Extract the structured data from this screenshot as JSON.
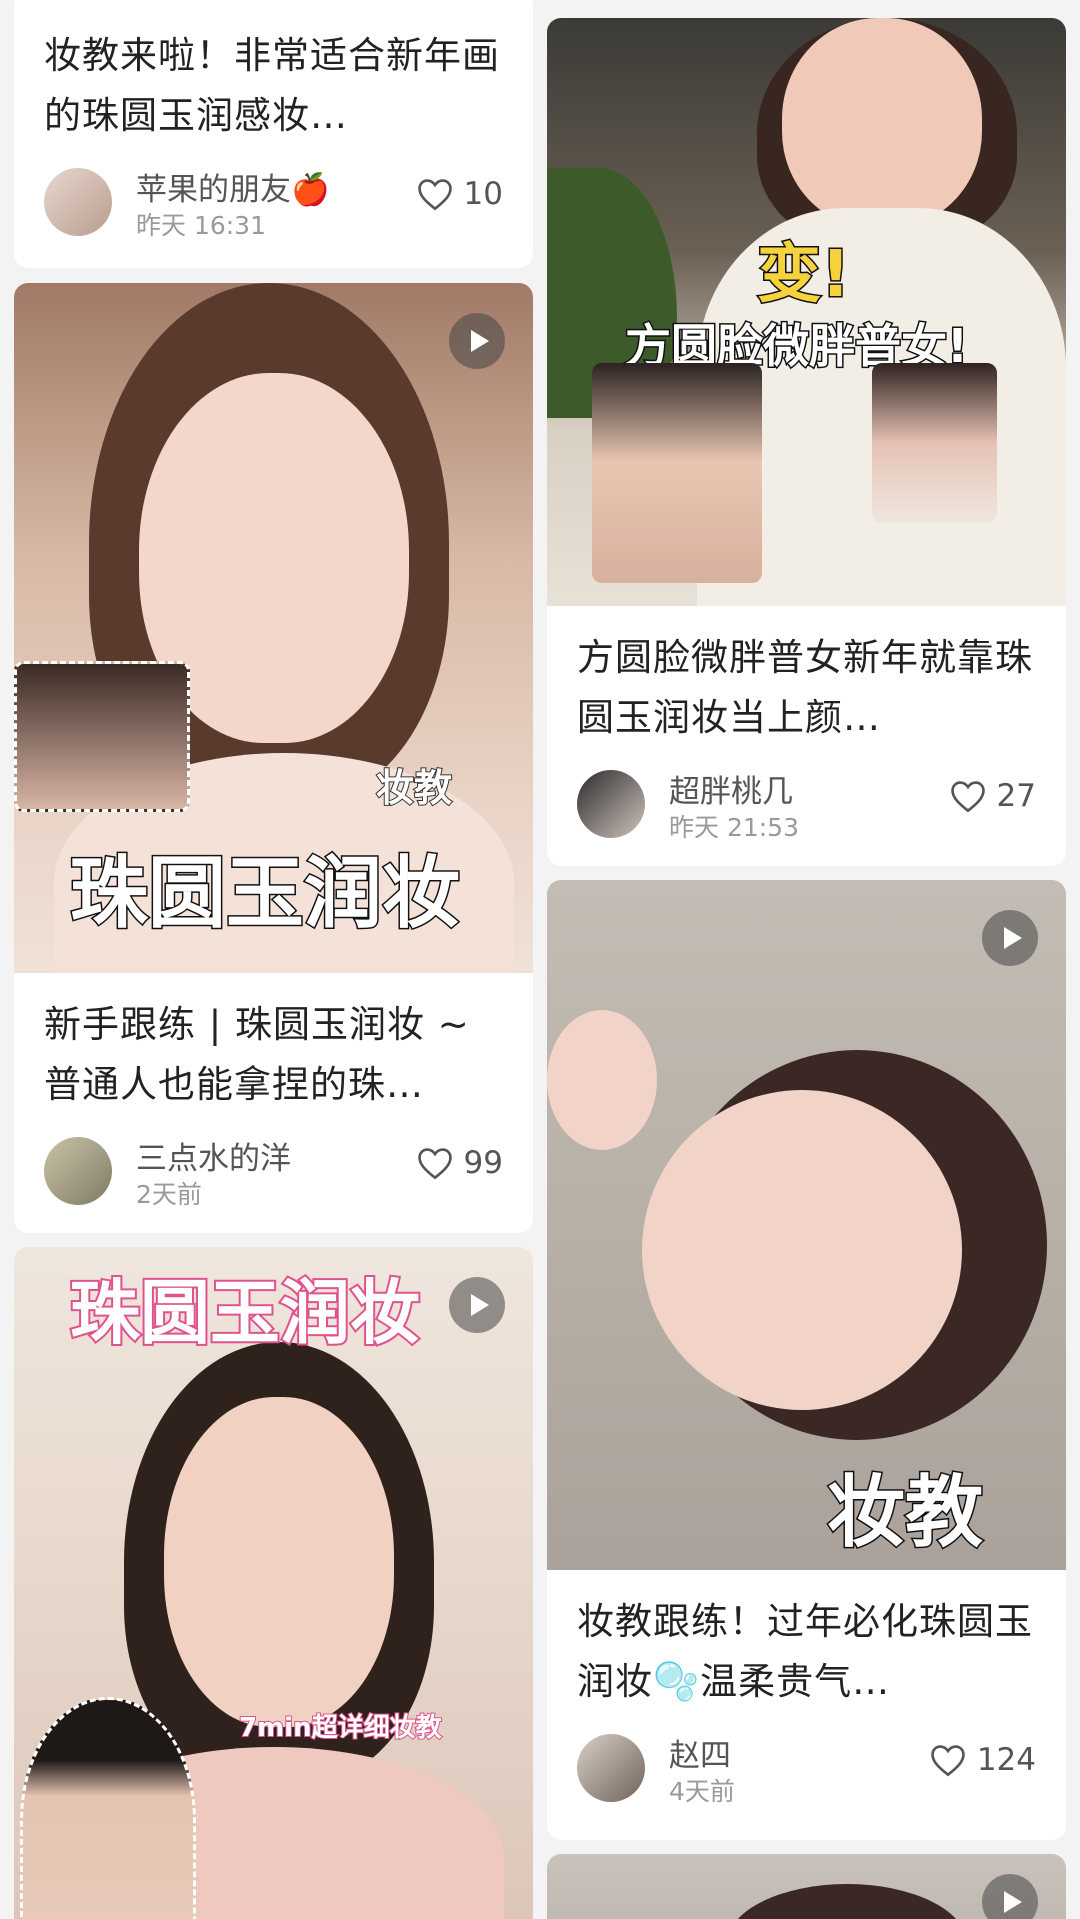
{
  "cards": [
    {
      "title": "妆教来啦！非常适合新年画的珠圆玉润感妆…",
      "author": "苹果的朋友🍎",
      "time": "昨天 16:31",
      "likes": "10"
    },
    {
      "title": "方圆脸微胖普女新年就靠珠圆玉润妆当上颜…",
      "author": "超胖桃几",
      "time": "昨天 21:53",
      "likes": "27",
      "cover_text": [
        "变!",
        "方圆脸微胖普女!"
      ]
    },
    {
      "title": "新手跟练 | 珠圆玉润妆 ~ 普通人也能拿捏的珠…",
      "author": "三点水的洋",
      "time": "2天前",
      "likes": "99",
      "cover_text": [
        "妆教",
        "珠圆玉润妆"
      ]
    },
    {
      "title": "妆教跟练！过年必化珠圆玉润妆🫧温柔贵气…",
      "author": "赵四",
      "time": "4天前",
      "likes": "124",
      "cover_text": [
        "妆教"
      ]
    },
    {
      "cover_text": [
        "珠圆玉润妆",
        "7min超详细妆教"
      ]
    }
  ],
  "colors": {
    "background": "#f3f3f3",
    "card": "#ffffff",
    "title_text": "#222222",
    "meta_text": "#555555",
    "time_text": "#9a9a9a",
    "heart": "#555555"
  },
  "icons": [
    "play-icon",
    "heart-icon",
    "avatar"
  ]
}
